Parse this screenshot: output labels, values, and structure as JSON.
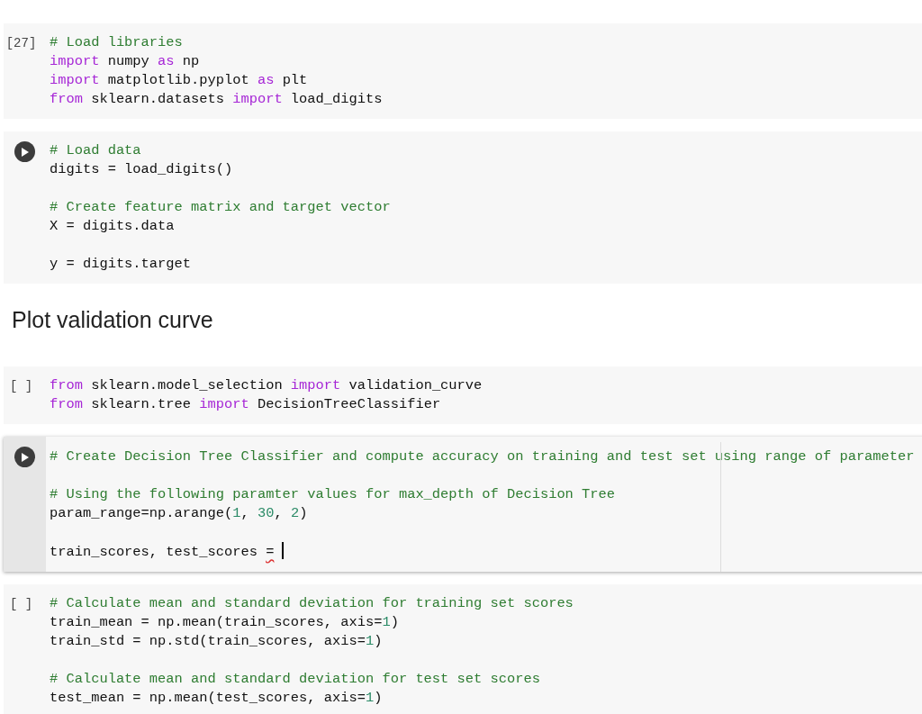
{
  "cells": [
    {
      "kind": "clipped"
    },
    {
      "kind": "code",
      "focused": false,
      "gutter": {
        "kind": "prompt",
        "text": "[27]"
      },
      "lines": [
        {
          "kind": "code",
          "tokens": [
            {
              "kind": "comment",
              "text": "# Load libraries"
            }
          ]
        },
        {
          "kind": "code",
          "tokens": [
            {
              "kind": "keyword",
              "text": "import"
            },
            {
              "kind": "plain",
              "text": " numpy "
            },
            {
              "kind": "keyword",
              "text": "as"
            },
            {
              "kind": "plain",
              "text": " np"
            }
          ]
        },
        {
          "kind": "code",
          "tokens": [
            {
              "kind": "keyword",
              "text": "import"
            },
            {
              "kind": "plain",
              "text": " matplotlib.pyplot "
            },
            {
              "kind": "keyword",
              "text": "as"
            },
            {
              "kind": "plain",
              "text": " plt"
            }
          ]
        },
        {
          "kind": "code",
          "tokens": [
            {
              "kind": "keyword",
              "text": "from"
            },
            {
              "kind": "plain",
              "text": " sklearn.datasets "
            },
            {
              "kind": "keyword",
              "text": "import"
            },
            {
              "kind": "plain",
              "text": " load_digits"
            }
          ]
        }
      ]
    },
    {
      "kind": "code",
      "focused": false,
      "gutter": {
        "kind": "run"
      },
      "lines": [
        {
          "kind": "code",
          "tokens": [
            {
              "kind": "comment",
              "text": "# Load data"
            }
          ]
        },
        {
          "kind": "code",
          "tokens": [
            {
              "kind": "plain",
              "text": "digits = load_digits()"
            }
          ]
        },
        {
          "kind": "blank"
        },
        {
          "kind": "code",
          "tokens": [
            {
              "kind": "comment",
              "text": "# Create feature matrix and target vector"
            }
          ]
        },
        {
          "kind": "code",
          "tokens": [
            {
              "kind": "plain",
              "text": "X = digits.data"
            }
          ]
        },
        {
          "kind": "blank"
        },
        {
          "kind": "code",
          "tokens": [
            {
              "kind": "plain",
              "text": "y = digits.target"
            }
          ]
        }
      ]
    },
    {
      "kind": "text",
      "heading": "Plot validation curve"
    },
    {
      "kind": "code",
      "focused": false,
      "gutter": {
        "kind": "prompt",
        "text": "[ ]"
      },
      "lines": [
        {
          "kind": "code",
          "tokens": [
            {
              "kind": "keyword",
              "text": "from"
            },
            {
              "kind": "plain",
              "text": " sklearn.model_selection "
            },
            {
              "kind": "keyword",
              "text": "import"
            },
            {
              "kind": "plain",
              "text": " validation_curve"
            }
          ]
        },
        {
          "kind": "code",
          "tokens": [
            {
              "kind": "keyword",
              "text": "from"
            },
            {
              "kind": "plain",
              "text": " sklearn.tree "
            },
            {
              "kind": "keyword",
              "text": "import"
            },
            {
              "kind": "plain",
              "text": " DecisionTreeClassifier"
            }
          ]
        }
      ]
    },
    {
      "kind": "code",
      "focused": true,
      "gutter": {
        "kind": "run"
      },
      "lines": [
        {
          "kind": "code",
          "tokens": [
            {
              "kind": "comment",
              "text": "# Create Decision Tree Classifier and compute accuracy on training and test set using range of parameter"
            }
          ]
        },
        {
          "kind": "blank"
        },
        {
          "kind": "code",
          "tokens": [
            {
              "kind": "comment",
              "text": "# Using the following paramter values for max_depth of Decision Tree"
            }
          ]
        },
        {
          "kind": "code",
          "tokens": [
            {
              "kind": "plain",
              "text": "param_range=np.arange("
            },
            {
              "kind": "number",
              "text": "1"
            },
            {
              "kind": "plain",
              "text": ", "
            },
            {
              "kind": "number",
              "text": "30"
            },
            {
              "kind": "plain",
              "text": ", "
            },
            {
              "kind": "number",
              "text": "2"
            },
            {
              "kind": "plain",
              "text": ")"
            }
          ]
        },
        {
          "kind": "blank"
        },
        {
          "kind": "code",
          "tokens": [
            {
              "kind": "plain",
              "text": "train_scores, test_scores "
            },
            {
              "kind": "error",
              "text": "="
            }
          ]
        }
      ]
    },
    {
      "kind": "code",
      "focused": false,
      "gutter": {
        "kind": "prompt",
        "text": "[ ]"
      },
      "lines": [
        {
          "kind": "code",
          "tokens": [
            {
              "kind": "comment",
              "text": "# Calculate mean and standard deviation for training set scores"
            }
          ]
        },
        {
          "kind": "code",
          "tokens": [
            {
              "kind": "plain",
              "text": "train_mean = np.mean(train_scores, axis="
            },
            {
              "kind": "number",
              "text": "1"
            },
            {
              "kind": "plain",
              "text": ")"
            }
          ]
        },
        {
          "kind": "code",
          "tokens": [
            {
              "kind": "plain",
              "text": "train_std = np.std(train_scores, axis="
            },
            {
              "kind": "number",
              "text": "1"
            },
            {
              "kind": "plain",
              "text": ")"
            }
          ]
        },
        {
          "kind": "blank"
        },
        {
          "kind": "code",
          "tokens": [
            {
              "kind": "comment",
              "text": "# Calculate mean and standard deviation for test set scores"
            }
          ]
        },
        {
          "kind": "code",
          "tokens": [
            {
              "kind": "plain",
              "text": "test_mean = np.mean(test_scores, axis="
            },
            {
              "kind": "number",
              "text": "1"
            },
            {
              "kind": "plain",
              "text": ")"
            }
          ]
        }
      ]
    }
  ]
}
